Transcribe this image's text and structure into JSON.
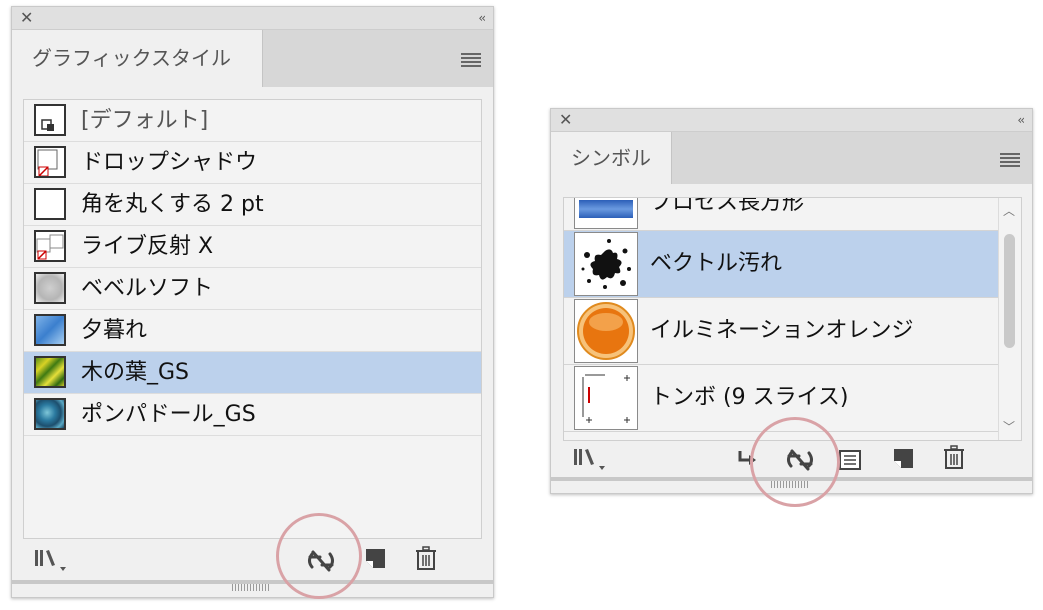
{
  "graphic_styles_panel": {
    "tab_label": "グラフィックスタイル",
    "styles": [
      {
        "label": "[デフォルト]"
      },
      {
        "label": "ドロップシャドウ"
      },
      {
        "label": "角を丸くする 2 pt"
      },
      {
        "label": "ライブ反射 X"
      },
      {
        "label": "ベベルソフト"
      },
      {
        "label": "夕暮れ"
      },
      {
        "label": "木の葉_GS",
        "selected": true
      },
      {
        "label": "ポンパドール_GS"
      }
    ],
    "footer_tools": [
      "library-icon",
      "break-link-icon",
      "new-style-icon",
      "trash-icon"
    ]
  },
  "symbols_panel": {
    "tab_label": "シンボル",
    "symbols": [
      {
        "label": "プロセス長方形"
      },
      {
        "label": "ベクトル汚れ",
        "selected": true
      },
      {
        "label": "イルミネーションオレンジ"
      },
      {
        "label": "トンボ (9 スライス)"
      }
    ],
    "footer_tools": [
      "library-icon",
      "place-instance-icon",
      "break-link-icon",
      "symbol-options-icon",
      "new-symbol-icon",
      "trash-icon"
    ]
  },
  "colors": {
    "selection": "#bcd1ec",
    "highlight_circle": "#d9a2a6",
    "panel_bg": "#f0f0f0"
  }
}
